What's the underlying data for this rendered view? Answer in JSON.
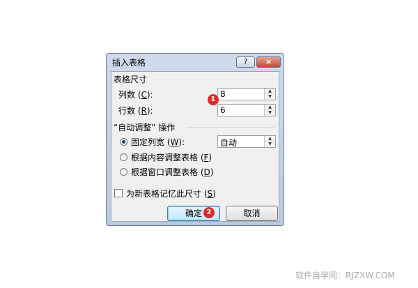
{
  "dialog": {
    "title": "插入表格",
    "help_label": "?",
    "close_label": "×"
  },
  "size_group": {
    "label": "表格尺寸",
    "columns_label": "列数",
    "columns_key": "C",
    "columns_value": "8",
    "rows_label": "行数",
    "rows_key": "R",
    "rows_value": "6"
  },
  "autofit_group": {
    "label": "“自动调整” 操作",
    "options": [
      {
        "label": "固定列宽",
        "key": "W",
        "suffix": ":",
        "selected": true
      },
      {
        "label": "根据内容调整表格",
        "key": "F",
        "suffix": "",
        "selected": false
      },
      {
        "label": "根据窗口调整表格",
        "key": "D",
        "suffix": "",
        "selected": false
      }
    ],
    "fixed_width_value": "自动"
  },
  "remember": {
    "label": "为新表格记忆此尺寸",
    "key": "S",
    "checked": false
  },
  "buttons": {
    "ok": "确定",
    "cancel": "取消"
  },
  "markers": {
    "first": "1",
    "second": "2"
  },
  "watermark": "软件自学网：RJZXW.COM"
}
